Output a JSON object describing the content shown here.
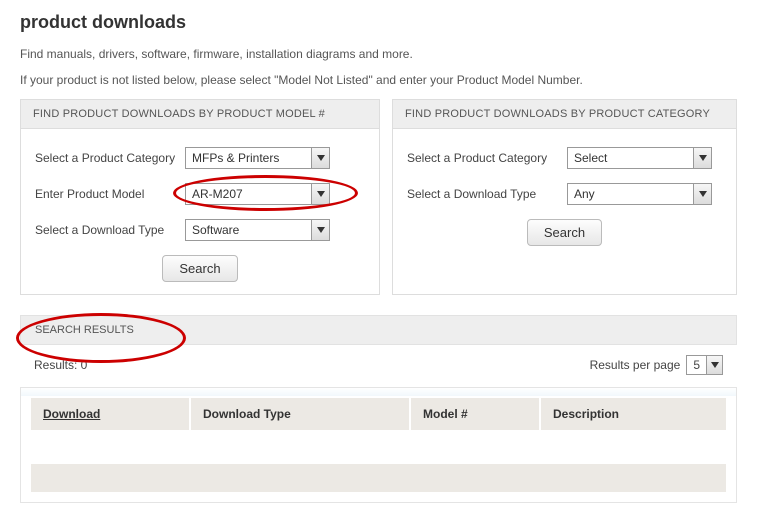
{
  "page": {
    "title": "product downloads",
    "intro1": "Find manuals, drivers, software, firmware, installation diagrams and more.",
    "intro2": "If your product is not listed below, please select \"Model Not Listed\" and enter your Product Model Number."
  },
  "panel_model": {
    "heading": "FIND PRODUCT DOWNLOADS BY PRODUCT MODEL #",
    "category_label": "Select a Product Category",
    "category_value": "MFPs & Printers",
    "model_label": "Enter Product Model",
    "model_value": "AR-M207",
    "type_label": "Select a Download Type",
    "type_value": "Software",
    "search_label": "Search"
  },
  "panel_category": {
    "heading": "FIND PRODUCT DOWNLOADS BY PRODUCT CATEGORY",
    "category_label": "Select a Product Category",
    "category_value": "Select",
    "type_label": "Select a Download Type",
    "type_value": "Any",
    "search_label": "Search"
  },
  "results": {
    "heading": "SEARCH RESULTS",
    "count_label": "Results: 0",
    "rpp_label": "Results per page",
    "rpp_value": "5",
    "columns": {
      "download": "Download",
      "download_type": "Download Type",
      "model": "Model #",
      "description": "Description"
    }
  }
}
